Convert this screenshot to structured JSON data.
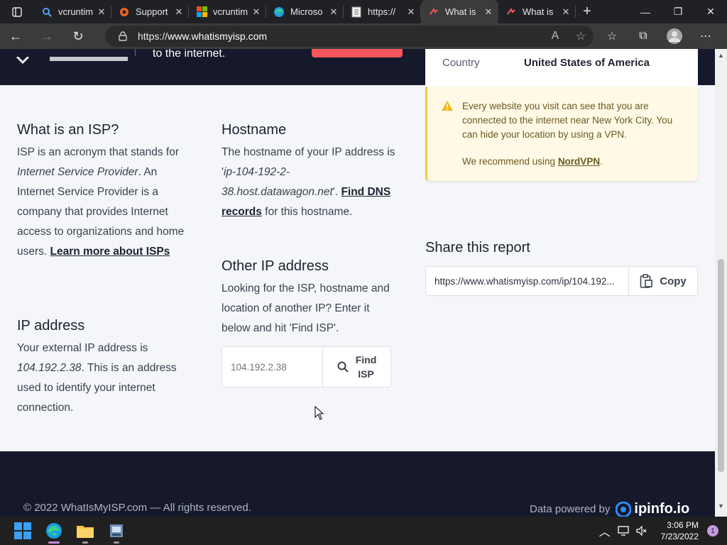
{
  "browser": {
    "tabs": [
      {
        "title": "vcruntim",
        "icon": "search-icon",
        "active": false
      },
      {
        "title": "Support",
        "icon": "gear-icon",
        "active": false
      },
      {
        "title": "vcruntim",
        "icon": "microsoft-logo-icon",
        "active": false
      },
      {
        "title": "Microso",
        "icon": "edge-icon",
        "active": false
      },
      {
        "title": "https://",
        "icon": "document-icon",
        "active": false
      },
      {
        "title": "What is",
        "icon": "whatismyisp-icon",
        "active": true
      },
      {
        "title": "What is",
        "icon": "whatismyisp-icon",
        "active": false
      }
    ],
    "url": {
      "scheme": "https://",
      "host": "www.whatismyisp.com"
    }
  },
  "hero": {
    "tagline": "to the internet."
  },
  "country": {
    "label": "Country",
    "value": "United States of America"
  },
  "warning": {
    "message": "Every website you visit can see that you are connected to the internet near New York City. You can hide your location by using a VPN.",
    "recommend_prefix": "We recommend using ",
    "recommend_link": "NordVPN",
    "recommend_suffix": "."
  },
  "isp_section": {
    "heading": "What is an ISP?",
    "p1": "ISP is an acronym that stands for ",
    "p1_em": "Internet Service Provider",
    "p2": ". An Internet Service Provider is a company that provides Internet access to organizations and home users. ",
    "link": "Learn more about ISPs"
  },
  "ip_section": {
    "heading": "IP address",
    "p1": "Your external IP address is ",
    "ip": "104.192.2.38",
    "p2": ". This is an address used to identify your internet connection."
  },
  "hostname_section": {
    "heading": "Hostname",
    "p1": "The hostname of your IP address is '",
    "hostname": "ip-104-192-2-38.host.datawagon.net",
    "p2": "'. ",
    "link": "Find DNS records",
    "p3": " for this hostname."
  },
  "other_ip": {
    "heading": "Other IP address",
    "text": "Looking for the ISP, hostname and location of another IP? Enter it below and hit 'Find ISP'.",
    "placeholder": "104.192.2.38",
    "button_line1": "Find",
    "button_line2": "ISP"
  },
  "share": {
    "heading": "Share this report",
    "url_value": "https://www.whatismyisp.com/ip/104.192...",
    "copy_label": "Copy"
  },
  "footer": {
    "copyright": "© 2022 WhatIsMyISP.com — All rights reserved.",
    "powered_by": "Data powered by",
    "brand": "ipinfo.io"
  },
  "taskbar": {
    "time": "3:06 PM",
    "date": "7/23/2022",
    "notification_count": "1"
  },
  "colors": {
    "hero_bg": "#16192b",
    "cta": "#f3565d",
    "warning_bg": "#fff9e6",
    "warning_border": "#f2c94c"
  }
}
